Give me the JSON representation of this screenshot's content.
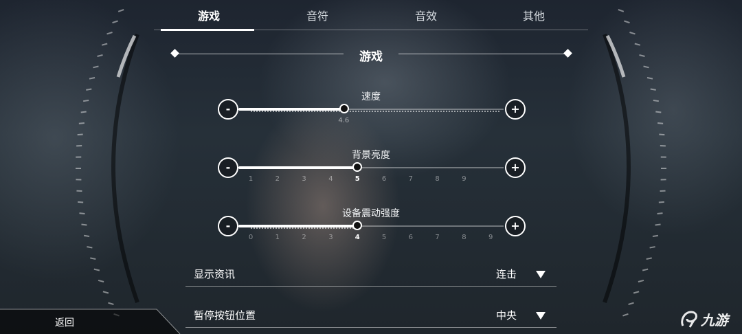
{
  "tabs": [
    {
      "label": "游戏",
      "active": true
    },
    {
      "label": "音符",
      "active": false
    },
    {
      "label": "音效",
      "active": false
    },
    {
      "label": "其他",
      "active": false
    }
  ],
  "section": {
    "title": "游戏"
  },
  "sliders": [
    {
      "label": "速度",
      "value": 4.6,
      "value_text": "4.6",
      "min": 1,
      "max": 10,
      "ticks": []
    },
    {
      "label": "背景亮度",
      "value": 5,
      "min": 0,
      "max": 10,
      "ticks": [
        "1",
        "2",
        "3",
        "4",
        "5",
        "6",
        "7",
        "8",
        "9"
      ]
    },
    {
      "label": "设备震动强度",
      "value": 4,
      "min": -1,
      "max": 10,
      "ticks": [
        "0",
        "1",
        "2",
        "3",
        "4",
        "5",
        "6",
        "7",
        "8",
        "9"
      ]
    }
  ],
  "buttons": {
    "minus": "-",
    "plus": "+"
  },
  "dropdowns": [
    {
      "label": "显示资讯",
      "value": "连击"
    },
    {
      "label": "暂停按钮位置",
      "value": "中央"
    }
  ],
  "back": {
    "label": "返回"
  },
  "watermark": {
    "text": "九游"
  },
  "colors": {
    "accent": "#ffffff",
    "background": "#232b33"
  }
}
